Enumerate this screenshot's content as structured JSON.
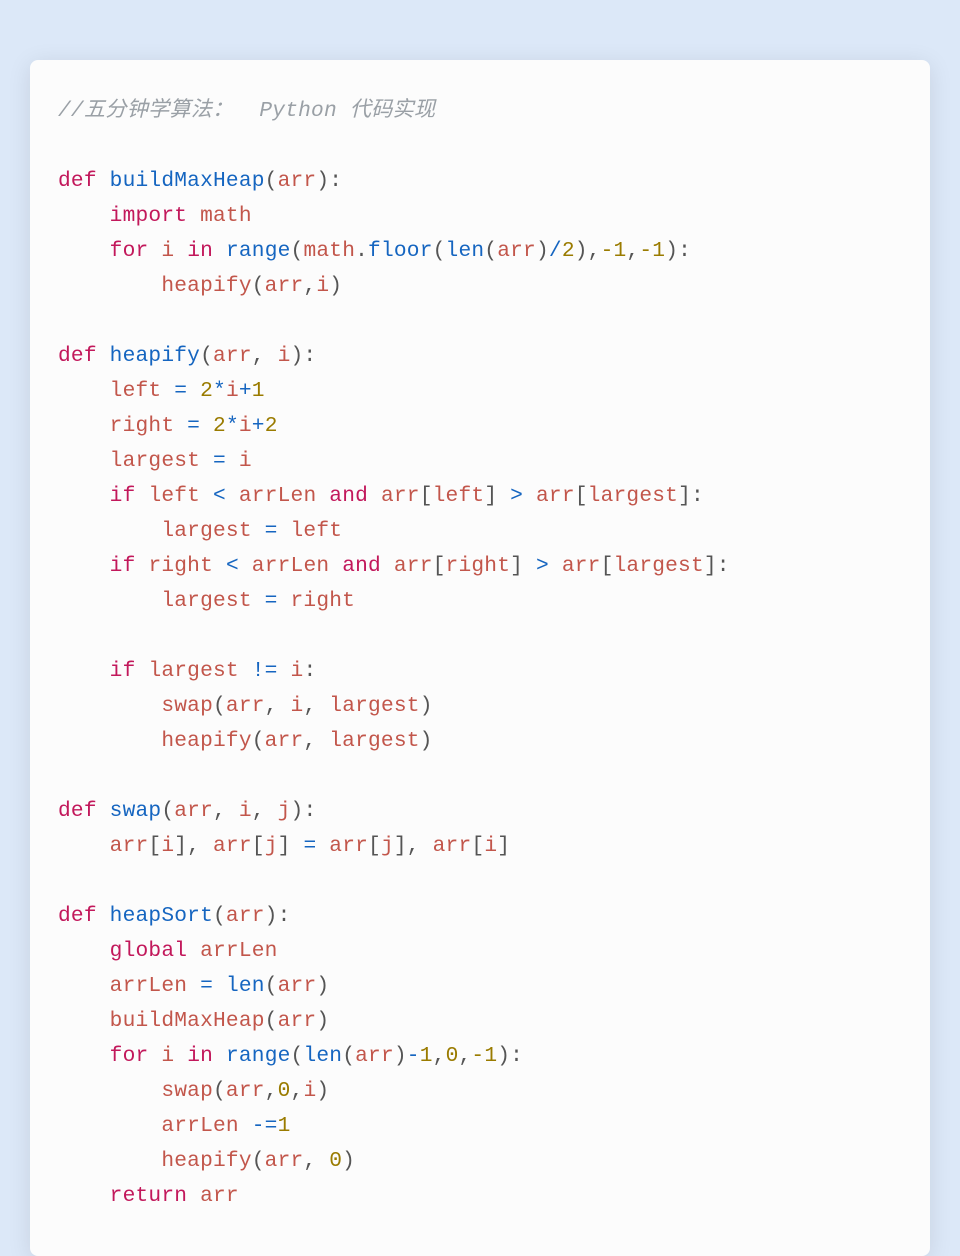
{
  "comment": "//五分钟学算法：  Python 代码实现",
  "kw": {
    "def": "def",
    "import": "import",
    "for": "for",
    "in": "in",
    "if": "if",
    "and": "and",
    "global": "global",
    "return": "return"
  },
  "fn": {
    "buildMaxHeap": "buildMaxHeap",
    "heapify": "heapify",
    "swap": "swap",
    "heapSort": "heapSort",
    "range": "range",
    "floor": "floor",
    "len": "len"
  },
  "id": {
    "arr": "arr",
    "math": "math",
    "i": "i",
    "j": "j",
    "left": "left",
    "right": "right",
    "largest": "largest",
    "arrLen": "arrLen"
  },
  "num": {
    "n0": "0",
    "n1": "1",
    "n2": "2",
    "neg1": "-1"
  }
}
